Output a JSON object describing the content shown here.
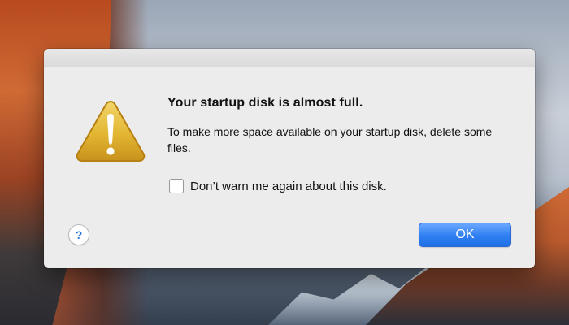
{
  "dialog": {
    "title": "Your startup disk is almost full.",
    "message": "To make more space available on your startup disk, delete some files.",
    "checkbox": {
      "label": "Don’t warn me again about this disk.",
      "checked": false
    },
    "help_button_label": "?",
    "ok_button_label": "OK",
    "icons": {
      "warning": "warning-triangle-icon",
      "help": "help-icon"
    },
    "colors": {
      "dialog_background": "#ececec",
      "ok_button": "#2f7ff2",
      "help_accent": "#2b74d8",
      "warning_yellow": "#e2b632"
    }
  }
}
